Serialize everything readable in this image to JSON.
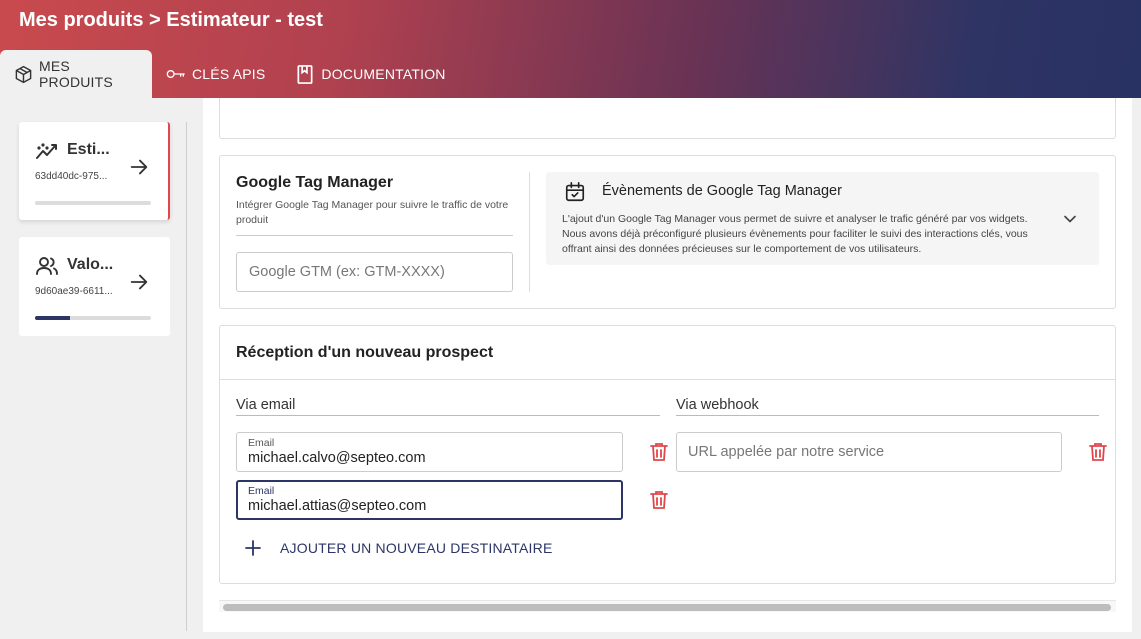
{
  "header": {
    "title": "Mes produits > Estimateur - test",
    "tabs": [
      {
        "label": "MES PRODUITS",
        "icon": "package-icon",
        "active": true
      },
      {
        "label": "CLÉS APIS",
        "icon": "key-icon",
        "active": false
      },
      {
        "label": "DOCUMENTATION",
        "icon": "book-icon",
        "active": false
      }
    ]
  },
  "sidebar": {
    "items": [
      {
        "name": "Esti...",
        "id": "63dd40dc-975...",
        "icon": "trend-icon",
        "progress": 0,
        "selected": true
      },
      {
        "name": "Valo...",
        "id": "9d60ae39-6611...",
        "icon": "users-icon",
        "progress": 0.3,
        "selected": false
      }
    ]
  },
  "gtm": {
    "title": "Google Tag Manager",
    "description": "Intégrer Google Tag Manager pour suivre le traffic de votre produit",
    "input_placeholder": "Google GTM (ex: GTM-XXXX)",
    "input_value": "",
    "events": {
      "title": "Évènements de Google Tag Manager",
      "text": "L'ajout d'un Google Tag Manager vous permet de suivre et analyser le trafic généré par vos widgets. Nous avons déjà préconfiguré plusieurs évènements pour faciliter le suivi des interactions clés, vous offrant ainsi des données précieuses sur le comportement de vos utilisateurs."
    }
  },
  "reception": {
    "title": "Réception d'un nouveau prospect",
    "via_email_label": "Via email",
    "via_webhook_label": "Via webhook",
    "email_field_label": "Email",
    "emails": [
      "michael.calvo@septeo.com",
      "michael.attias@septeo.com"
    ],
    "webhook_placeholder": "URL appelée par notre service",
    "add_recipient_label": "AJOUTER UN NOUVEAU DESTINATAIRE"
  },
  "colors": {
    "accent": "#2c3566",
    "danger": "#e0474c",
    "header_start": "#c94a4e",
    "header_end": "#283263"
  }
}
